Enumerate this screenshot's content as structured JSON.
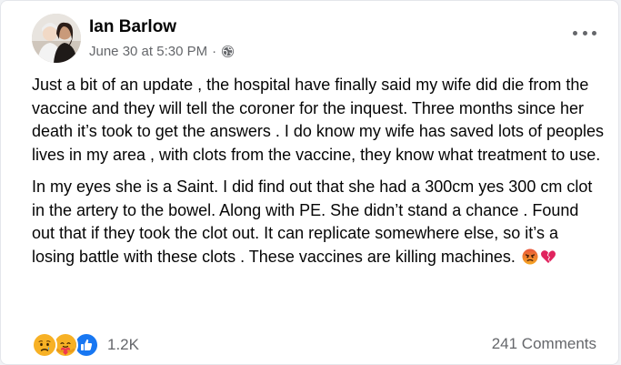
{
  "post": {
    "author": "Ian Barlow",
    "timestamp": "June 30 at 5:30 PM",
    "separator": "·",
    "privacy_icon": "globe-icon",
    "paragraphs": [
      "Just a bit of an update , the hospital have finally said my wife did die from the vaccine and they will tell the coroner for the inquest. Three months since her death it’s took to get the answers . I do know my wife has saved lots of peoples lives in my area , with clots from the vaccine, they know what treatment to use.",
      "In my eyes she is a Saint. I did find out that she had a 300cm yes 300 cm clot in the artery to the bowel. Along with PE. She didn’t stand a chance . Found out that if they took the clot out. It can replicate somewhere else, so it’s a losing battle with these clots . These vaccines are killing machines."
    ],
    "inline_emojis": [
      "angry-face-emoji",
      "broken-heart-emoji"
    ]
  },
  "reactions": {
    "icons": [
      "sad-reaction-icon",
      "care-reaction-icon",
      "like-reaction-icon"
    ],
    "count": "1.2K"
  },
  "comments": {
    "label": "241 Comments"
  },
  "colors": {
    "secondary_text": "#65676b",
    "like_blue": "#1877f2",
    "reaction_yellow": "#f7b125"
  }
}
